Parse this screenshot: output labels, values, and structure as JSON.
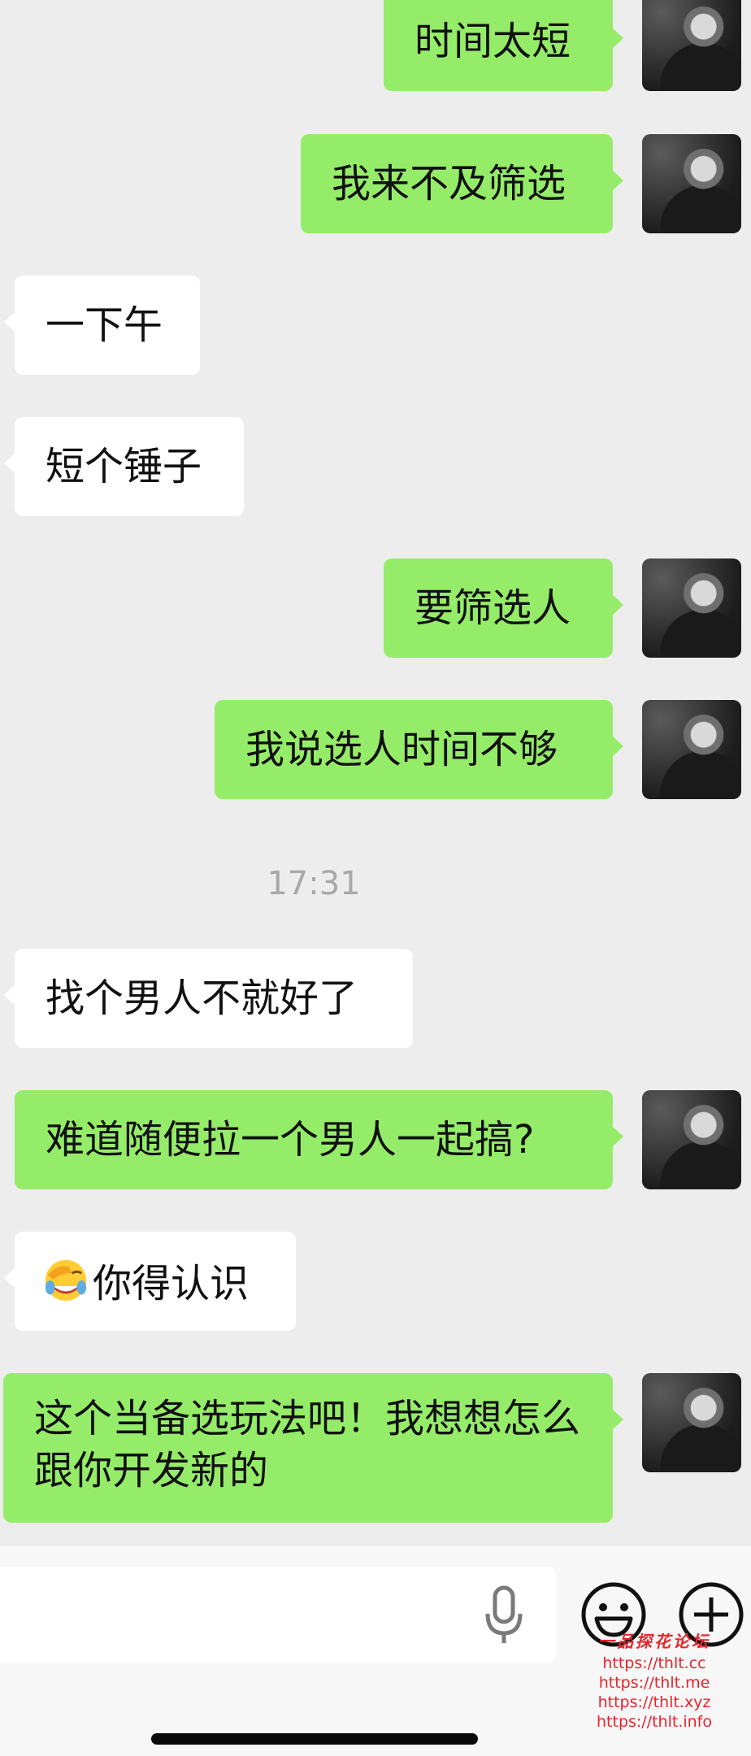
{
  "messages": [
    {
      "side": "me",
      "text": "时间太短"
    },
    {
      "side": "me",
      "text": "我来不及筛选"
    },
    {
      "side": "them",
      "text": "一下午"
    },
    {
      "side": "them",
      "text": "短个锤子"
    },
    {
      "side": "me",
      "text": "要筛选人"
    },
    {
      "side": "me",
      "text": "我说选人时间不够"
    },
    {
      "side": "them",
      "text": "找个男人不就好了"
    },
    {
      "side": "me",
      "text": "难道随便拉一个男人一起搞?"
    },
    {
      "side": "them",
      "text": "你得认识",
      "emoji": "face-palm-tears-emoji"
    },
    {
      "side": "me",
      "text": "这个当备选玩法吧！我想想怎么跟你开发新的"
    }
  ],
  "timestamp": "17:31",
  "input": {
    "placeholder": "",
    "mic_icon": "microphone-icon",
    "emoji_icon": "smiley-face-icon",
    "plus_icon": "plus-circle-icon"
  },
  "watermark": {
    "title": "一品探花论坛",
    "urls": [
      "https://thlt.cc",
      "https://thlt.me",
      "https://thlt.xyz",
      "https://thlt.info"
    ]
  },
  "colors": {
    "background": "#ededed",
    "my_bubble": "#95ec69",
    "their_bubble": "#ffffff",
    "timestamp": "#a8a8a8",
    "watermark": "#e8232a"
  }
}
